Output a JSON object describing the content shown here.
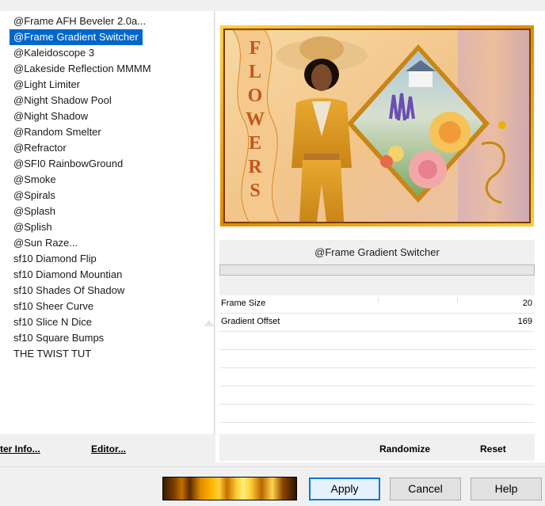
{
  "filter_list": {
    "items": [
      {
        "label": "@Frame AFH Beveler 2.0a...",
        "selected": false
      },
      {
        "label": "@Frame Gradient Switcher",
        "selected": true
      },
      {
        "label": "@Kaleidoscope 3",
        "selected": false
      },
      {
        "label": "@Lakeside Reflection MMMM",
        "selected": false
      },
      {
        "label": "@Light Limiter",
        "selected": false
      },
      {
        "label": "@Night Shadow Pool",
        "selected": false
      },
      {
        "label": "@Night Shadow",
        "selected": false
      },
      {
        "label": "@Random Smelter",
        "selected": false
      },
      {
        "label": "@Refractor",
        "selected": false
      },
      {
        "label": "@SFI0 RainbowGround",
        "selected": false
      },
      {
        "label": "@Smoke",
        "selected": false
      },
      {
        "label": "@Spirals",
        "selected": false
      },
      {
        "label": "@Splash",
        "selected": false
      },
      {
        "label": "@Splish",
        "selected": false
      },
      {
        "label": "@Sun Raze...",
        "selected": false
      },
      {
        "label": "sf10 Diamond Flip",
        "selected": false
      },
      {
        "label": "sf10 Diamond Mountian",
        "selected": false
      },
      {
        "label": "sf10 Shades Of Shadow",
        "selected": false
      },
      {
        "label": "sf10 Sheer Curve",
        "selected": false
      },
      {
        "label": "sf10 Slice N Dice",
        "selected": false
      },
      {
        "label": "sf10 Square Bumps",
        "selected": false
      },
      {
        "label": "THE TWIST TUT",
        "selected": false
      }
    ],
    "filter_info_label": "ter Info...",
    "editor_label": "Editor..."
  },
  "preview": {
    "side_text": "FLOWERS",
    "frame_color": "#f2a800"
  },
  "filter": {
    "name": "@Frame Gradient Switcher",
    "params": [
      {
        "name": "Frame Size",
        "value": "20"
      },
      {
        "name": "Gradient Offset",
        "value": "169"
      }
    ],
    "randomize_label": "Randomize",
    "reset_label": "Reset"
  },
  "dialog": {
    "apply_label": "Apply",
    "cancel_label": "Cancel",
    "help_label": "Help"
  },
  "colors": {
    "selection": "#0066cc",
    "focus_border": "#0078d7"
  }
}
